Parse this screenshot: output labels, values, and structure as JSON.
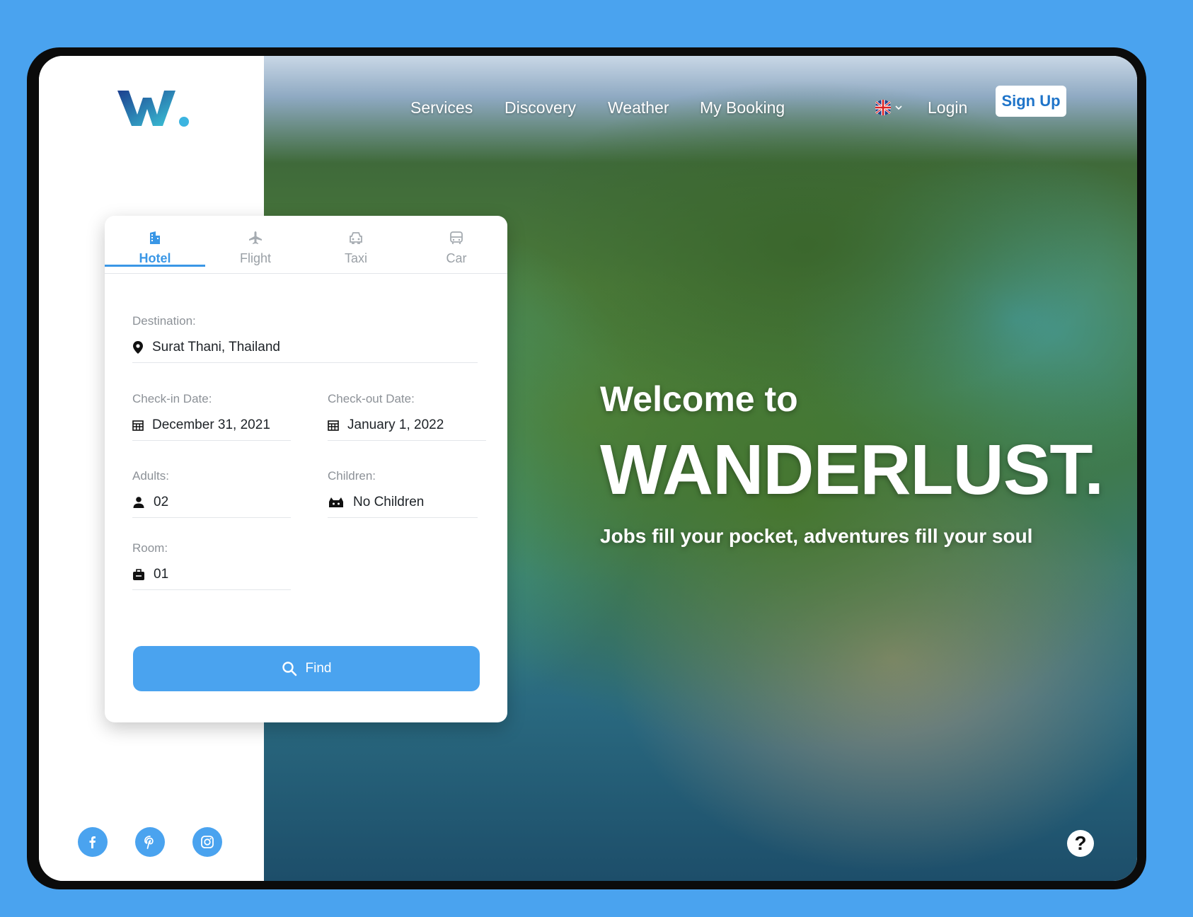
{
  "brand": {
    "logo_alt": "W."
  },
  "nav": {
    "items": [
      "Services",
      "Discovery",
      "Weather",
      "My Booking"
    ],
    "language_icon": "uk-flag-icon",
    "login": "Login",
    "signup": "Sign Up"
  },
  "booking": {
    "tabs": [
      {
        "label": "Hotel",
        "icon": "hotel-icon",
        "active": true
      },
      {
        "label": "Flight",
        "icon": "plane-icon",
        "active": false
      },
      {
        "label": "Taxi",
        "icon": "taxi-icon",
        "active": false
      },
      {
        "label": "Car",
        "icon": "car-icon",
        "active": false
      }
    ],
    "destination": {
      "label": "Destination:",
      "value": "Surat Thani, Thailand"
    },
    "checkin": {
      "label": "Check-in Date:",
      "value": "December 31, 2021"
    },
    "checkout": {
      "label": "Check-out Date:",
      "value": "January 1, 2022"
    },
    "adults": {
      "label": "Adults:",
      "value": "02"
    },
    "children": {
      "label": "Children:",
      "value": "No Children"
    },
    "room": {
      "label": "Room:",
      "value": "01"
    },
    "find": "Find"
  },
  "hero": {
    "welcome": "Welcome to",
    "brand": "WANDERLUST.",
    "tagline": "Jobs fill your pocket, adventures fill your soul"
  },
  "social": [
    "facebook-icon",
    "pinterest-icon",
    "instagram-icon"
  ],
  "help": "?",
  "colors": {
    "accent": "#4aa3ef",
    "tab_active": "#3a97e6",
    "signup_text": "#1f74c9"
  }
}
